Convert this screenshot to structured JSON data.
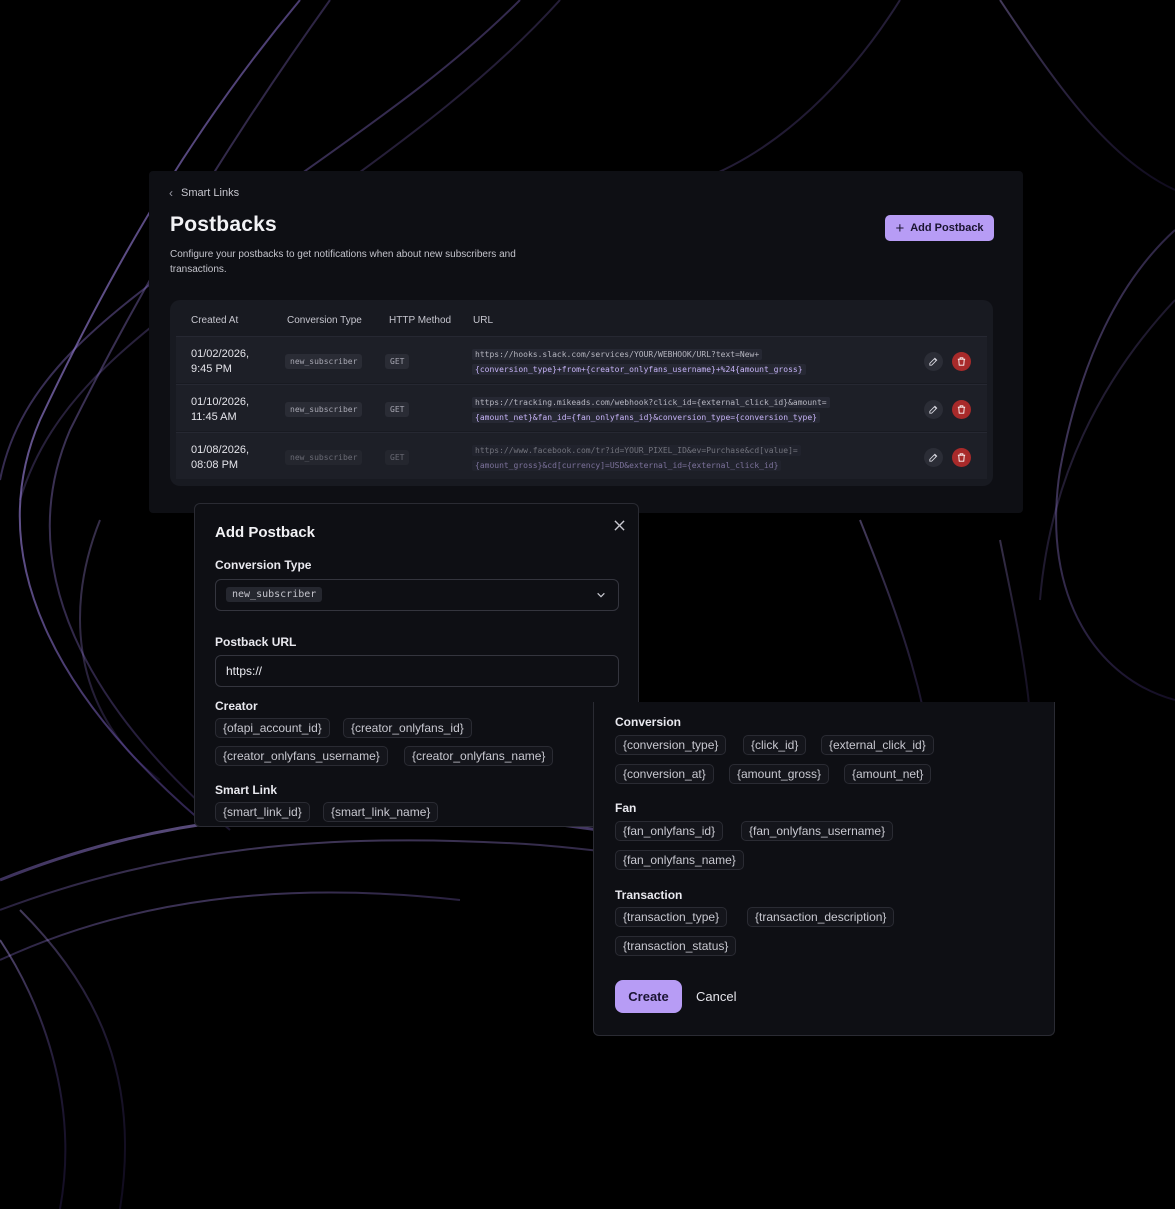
{
  "breadcrumb": {
    "label": "Smart Links"
  },
  "page": {
    "title": "Postbacks",
    "description": "Configure your postbacks to get notifications when about new subscribers and transactions.",
    "add_button": "Add Postback"
  },
  "table": {
    "headers": {
      "created_at": "Created At",
      "conversion_type": "Conversion Type",
      "http_method": "HTTP Method",
      "url": "URL"
    },
    "rows": [
      {
        "date1": "01/02/2026,",
        "date2": "9:45 PM",
        "conversion_type": "new_subscriber",
        "method": "GET",
        "url_line1": "https://hooks.slack.com/services/YOUR/WEBHOOK/URL?text=New+",
        "url_line2": "{conversion_type}+from+{creator_onlyfans_username}+%24{amount_gross}"
      },
      {
        "date1": "01/10/2026,",
        "date2": "11:45 AM",
        "conversion_type": "new_subscriber",
        "method": "GET",
        "url_line1": "https://tracking.mikeads.com/webhook?click_id={external_click_id}&amount=",
        "url_line2": "{amount_net}&fan_id={fan_onlyfans_id}&conversion_type={conversion_type}"
      },
      {
        "date1": "01/08/2026,",
        "date2": "08:08 PM",
        "conversion_type": "new_subscriber",
        "method": "GET",
        "url_line1": "https://www.facebook.com/tr?id=YOUR_PIXEL_ID&ev=Purchase&cd[value]=",
        "url_line2": "{amount_gross}&cd[currency]=USD&external_id={external_click_id}"
      }
    ]
  },
  "modal": {
    "title": "Add Postback",
    "conversion_type_label": "Conversion Type",
    "conversion_type_value": "new_subscriber",
    "postback_url_label": "Postback URL",
    "postback_url_value": "https://",
    "creator_label": "Creator",
    "creator_vars": [
      "{ofapi_account_id}",
      "{creator_onlyfans_id}",
      "{creator_onlyfans_username}",
      "{creator_onlyfans_name}"
    ],
    "smart_link_label": "Smart Link",
    "smart_link_vars": [
      "{smart_link_id}",
      "{smart_link_name}"
    ]
  },
  "vars_panel": {
    "conversion_label": "Conversion",
    "conversion_vars": [
      "{conversion_type}",
      "{click_id}",
      "{external_click_id}",
      "{conversion_at}",
      "{amount_gross}",
      "{amount_net}"
    ],
    "fan_label": "Fan",
    "fan_vars": [
      "{fan_onlyfans_id}",
      "{fan_onlyfans_username}",
      "{fan_onlyfans_name}"
    ],
    "transaction_label": "Transaction",
    "transaction_vars": [
      "{transaction_type}",
      "{transaction_description}",
      "{transaction_status}"
    ],
    "create_button": "Create",
    "cancel_button": "Cancel"
  },
  "colors": {
    "accent": "#b79cf5",
    "danger": "#a82a2a",
    "surface": "#0e0f14",
    "table": "#181a21"
  }
}
